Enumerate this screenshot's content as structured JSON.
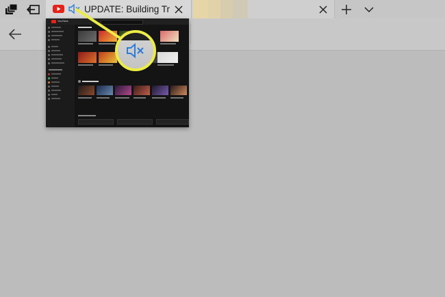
{
  "tab": {
    "title": "UPDATE: Building Tr",
    "favicon": "youtube-icon",
    "audio": "muted-speaker-icon"
  },
  "colors": {
    "youtube_red": "#e62117",
    "accent_blue": "#2b7bd9",
    "highlight_yellow": "#ecec44",
    "tabstrip": "#c6c6c6"
  },
  "icons": {
    "strip": [
      "tab-actions-icon",
      "set-tabs-aside-icon"
    ],
    "tabbar": [
      "close-icon",
      "close-icon",
      "plus-icon",
      "chevron-down-icon"
    ],
    "nav": [
      "back-arrow-icon"
    ]
  },
  "preview": {
    "site": "YouTube"
  }
}
